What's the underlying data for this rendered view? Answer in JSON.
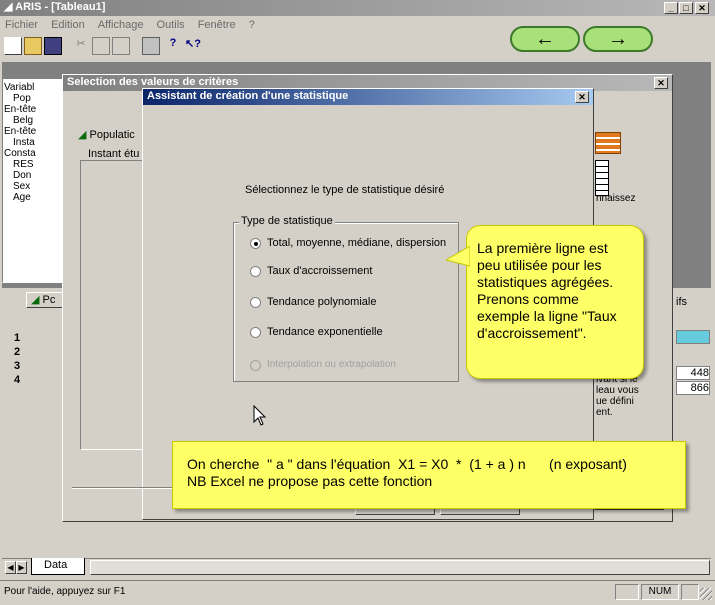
{
  "app": {
    "title": "ARIS - [Tableau1]"
  },
  "menu": [
    "Fichier",
    "Edition",
    "Affichage",
    "Outils",
    "Fenêtre",
    "?"
  ],
  "nav": {
    "back": "←",
    "forward": "→"
  },
  "left_panel": {
    "items": [
      "Variabl",
      "Pop",
      "En-tête",
      "Belg",
      "En-tête",
      "Insta",
      "Consta",
      "RES",
      "Don",
      "Sex",
      "Age"
    ]
  },
  "grid": {
    "tab_label": "Pc",
    "rows": [
      "1",
      "2",
      "3",
      "4"
    ],
    "right_values": [
      "448",
      "866"
    ],
    "right_header": "ifs"
  },
  "dialog_back": {
    "title": "Selection des valeurs de critères",
    "population_label": "Populatic",
    "instant_label": "Instant étu",
    "right_text_1": "nnaissez",
    "right_text_2": "ivant si le\nleau vous\nue défini\nent."
  },
  "dialog_front": {
    "title": "Assistant de création d'une statistique",
    "prompt": "Sélectionnez le type de statistique désiré",
    "group_label": "Type de statistique",
    "options": [
      {
        "label": "Total, moyenne, médiane, dispersion",
        "selected": true,
        "enabled": true
      },
      {
        "label": "Taux d'accroissement",
        "selected": false,
        "enabled": true
      },
      {
        "label": "Tendance polynomiale",
        "selected": false,
        "enabled": true
      },
      {
        "label": "Tendance exponentielle",
        "selected": false,
        "enabled": true
      },
      {
        "label": "Interpolation ou extrapolation",
        "selected": false,
        "enabled": false
      }
    ]
  },
  "callouts": {
    "first": "La première ligne est peu utilisée pour les statistiques agrégées. Prenons comme exemple la ligne \"Taux d'accroissement\".",
    "second_line1": "On cherche  \" a \" dans l'équation  X1 = X0  *  (1 + a ) n      (n exposant)",
    "second_line2": "NB Excel ne propose pas cette fonction"
  },
  "sheet_tab": {
    "label": "Data"
  },
  "status": {
    "help": "Pour l'aide, appuyez sur F1",
    "num": "NUM"
  }
}
